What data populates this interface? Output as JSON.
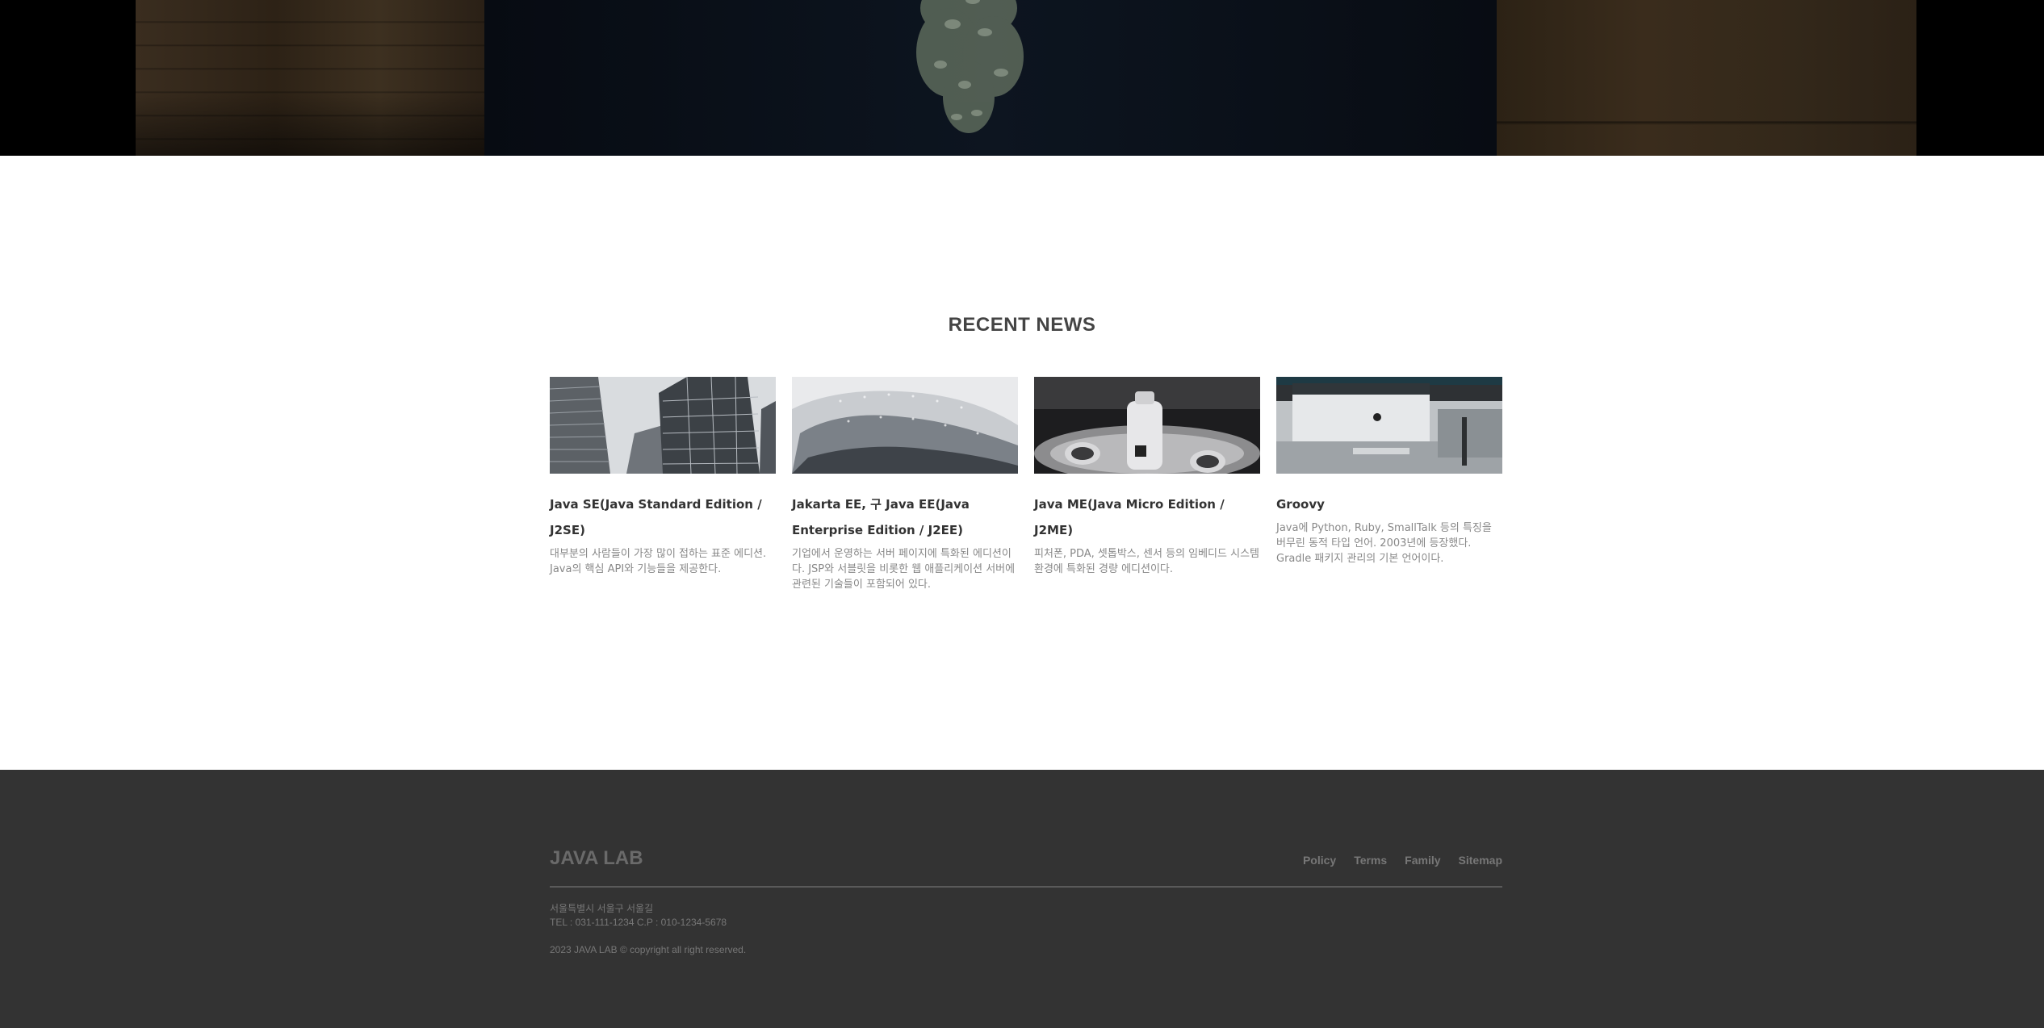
{
  "news": {
    "title": "RECENT NEWS",
    "cards": [
      {
        "title": "Java SE(Java Standard Edition / J2SE)",
        "desc": "대부분의 사람들이 가장 많이 접하는 표준 에디션. Java의 핵심 API와 기능들을 제공한다."
      },
      {
        "title": "Jakarta EE, 구 Java EE(Java Enterprise Edition / J2EE)",
        "desc": "기업에서 운영하는 서버 페이지에 특화된 에디션이다. JSP와 서블릿을 비롯한 웹 애플리케이션 서버에 관련된 기술들이 포함되어 있다."
      },
      {
        "title": "Java ME(Java Micro Edition / J2ME)",
        "desc": "피처폰, PDA, 셋톱박스, 센서 등의 임베디드 시스템 환경에 특화된 경량 에디션이다."
      },
      {
        "title": "Groovy",
        "desc": "Java에 Python, Ruby, SmallTalk 등의 특징을 버무린 동적 타입 언어. 2003년에 등장했다. Gradle 패키지 관리의 기본 언어이다."
      }
    ]
  },
  "footer": {
    "logo": "JAVA LAB",
    "links": [
      "Policy",
      "Terms",
      "Family",
      "Sitemap"
    ],
    "address": "서울특별시 서울구 서울길",
    "tel": "TEL : 031-111-1234 C.P : 010-1234-5678",
    "copyright": "2023 JAVA LAB © copyright all right reserved."
  }
}
